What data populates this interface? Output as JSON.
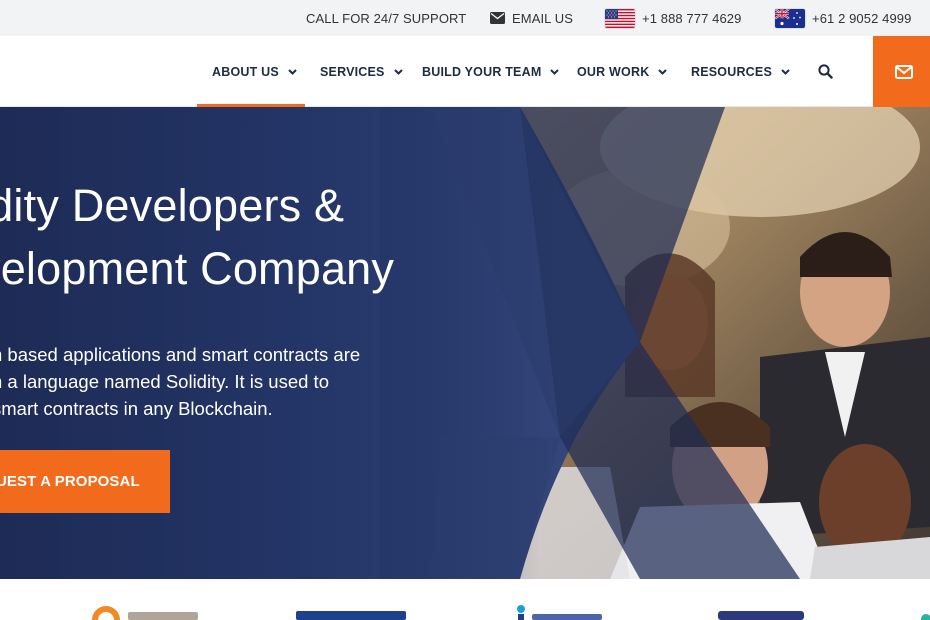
{
  "topbar": {
    "support": "CALL FOR 24/7 SUPPORT",
    "email": "EMAIL US",
    "phone_us": "+1 888 777 4629",
    "phone_au": "+61 2 9052 4999",
    "icons": {
      "email": "envelope-icon",
      "us": "us-flag-icon",
      "au": "au-flag-icon"
    }
  },
  "nav": {
    "items": [
      {
        "label": "ABOUT US"
      },
      {
        "label": "SERVICES"
      },
      {
        "label": "BUILD YOUR TEAM"
      },
      {
        "label": "OUR WORK"
      },
      {
        "label": "RESOURCES"
      }
    ],
    "active": "ABOUT US",
    "icons": {
      "search": "search-icon",
      "contact": "envelope-icon"
    }
  },
  "hero": {
    "title_line1": "idity Developers &",
    "title_line2": "velopment Company",
    "desc_line1": "n based applications and smart contracts are",
    "desc_line2": "n a language named Solidity. It is used to",
    "desc_line3": "smart contracts in any Blockchain.",
    "cta": "UEST A PROPOSAL"
  },
  "colors": {
    "accent": "#f26b1d",
    "navy": "#1f2d55",
    "nav_text": "#1f2a44",
    "topbar_bg": "#f2f3f5"
  }
}
